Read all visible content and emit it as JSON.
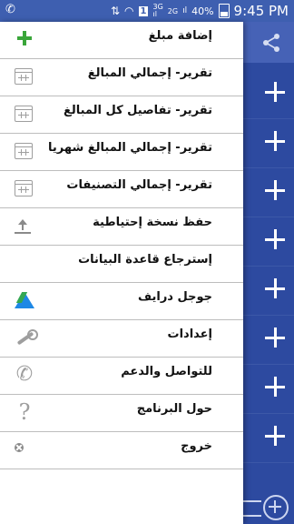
{
  "status_bar": {
    "network_3g_top": "3G",
    "network_3g_bottom": "ıl",
    "network_2g": "2G",
    "signal_suffix": "ıl",
    "battery_percent": "40%",
    "time": "9:45 PM",
    "sim_badge": "1"
  },
  "drawer": {
    "items": [
      {
        "label": "إضافة مبلغ",
        "icon": "add-icon"
      },
      {
        "label": "تقرير- إجمالي المبالغ",
        "icon": "calendar-icon"
      },
      {
        "label": "تقرير- تفاصيل كل المبالغ",
        "icon": "calendar-icon"
      },
      {
        "label": "تقرير- إجمالي المبالغ شهريا",
        "icon": "calendar-icon"
      },
      {
        "label": "تقرير- إجمالي التصنيفات",
        "icon": "calendar-icon"
      },
      {
        "label": "حفظ نسخة إحتياطية",
        "icon": "upload-icon"
      },
      {
        "label": "إسترجاع قاعدة البيانات",
        "icon": ""
      },
      {
        "label": "جوجل درايف",
        "icon": "google-drive-icon"
      },
      {
        "label": "إعدادات",
        "icon": "wrench-icon"
      },
      {
        "label": "للتواصل والدعم",
        "icon": "phone-icon"
      },
      {
        "label": "حول البرنامج",
        "icon": "question-icon"
      },
      {
        "label": "خروج",
        "icon": "close-circle-icon"
      }
    ]
  },
  "colors": {
    "status_bar": "#3e5fb0",
    "background_app": "#2d4aa0",
    "accent_green": "#3aa63a",
    "drive_blue": "#1e88e5"
  }
}
